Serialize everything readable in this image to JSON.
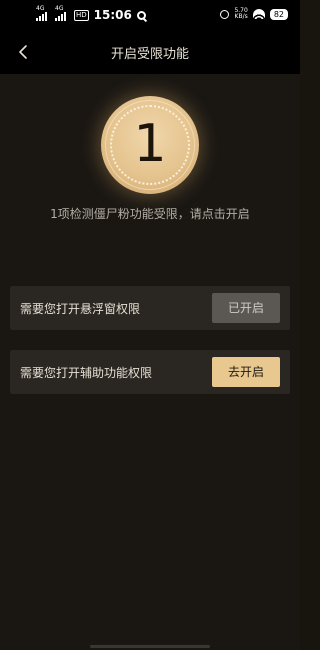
{
  "status_bar": {
    "network1": "4G",
    "network2": "4G",
    "hd": "HD",
    "time": "15:06",
    "speed_value": "5.70",
    "speed_unit": "KB/s",
    "battery": "82"
  },
  "header": {
    "title": "开启受限功能"
  },
  "coin": {
    "count": "1"
  },
  "hint": "1项检测僵尸粉功能受限，请点击开启",
  "permissions": [
    {
      "label": "需要您打开悬浮窗权限",
      "button": "已开启",
      "state": "enabled"
    },
    {
      "label": "需要您打开辅助功能权限",
      "button": "去开启",
      "state": "disabled"
    }
  ],
  "colors": {
    "background": "#1a1713",
    "accent_gold": "#e8c88f",
    "row_bg": "#2a2622",
    "enabled_button": "#5b5854"
  },
  "icons": {
    "back": "back-arrow-icon"
  }
}
